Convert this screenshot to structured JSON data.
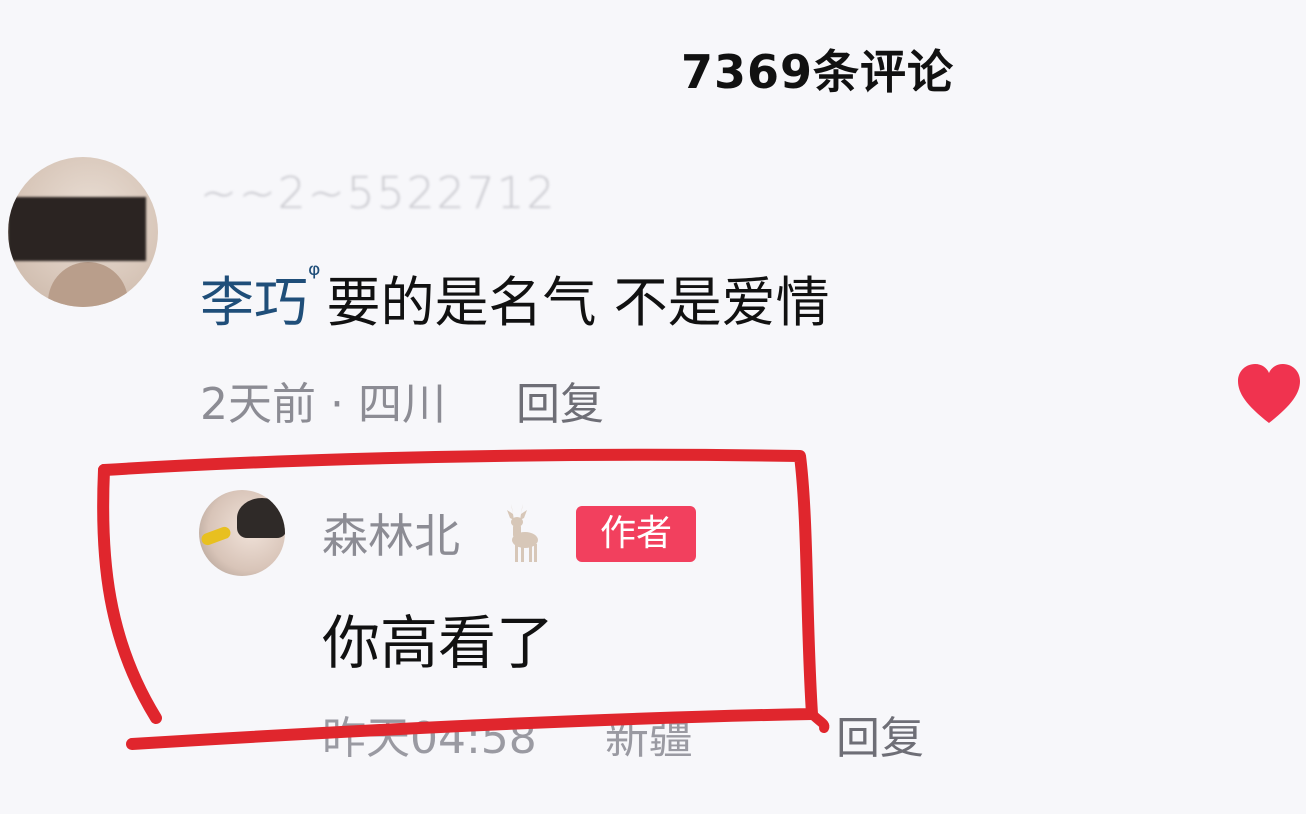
{
  "header": {
    "title": "7369条评论"
  },
  "comment": {
    "username_obscured": "~~2~5522712",
    "mention": "李巧",
    "text": "要的是名气  不是爱情",
    "time": "2天前",
    "separator": "·",
    "location": "四川",
    "reply_label": "回复",
    "like_color": "#f0334f"
  },
  "reply": {
    "author": "森林北",
    "badge": "作者",
    "badge_color": "#f2405e",
    "text": "你高看了",
    "time": "昨天04:58",
    "location": "新疆",
    "reply_label": "回复"
  },
  "annotation": {
    "color": "#e0262d",
    "icon": "hand-drawn-highlight-box"
  }
}
